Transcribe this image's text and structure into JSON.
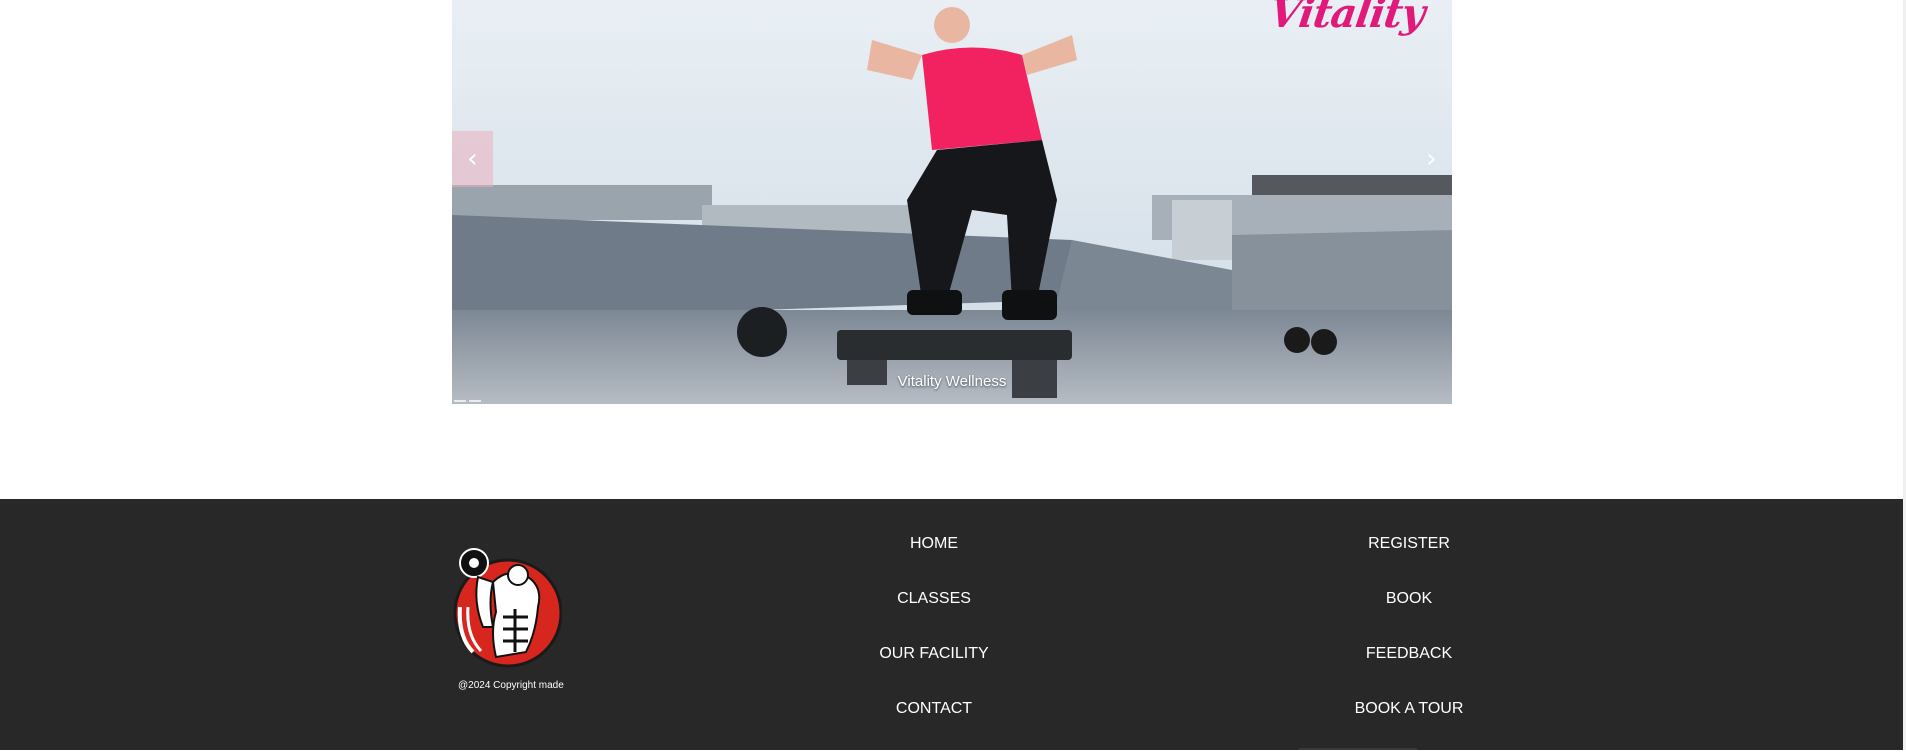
{
  "carousel": {
    "brand_text": "Vitality",
    "caption": "Vitality Wellness",
    "prev_label": "‹",
    "next_label": "›",
    "colors": {
      "accent_pink": "#e0197a",
      "sky": "#dfe8ef",
      "concrete": "#8f98a3"
    }
  },
  "footer": {
    "copyright": "@2024 Copyright made",
    "nav_left": [
      {
        "label": "HOME"
      },
      {
        "label": "CLASSES"
      },
      {
        "label": "OUR FACILITY"
      },
      {
        "label": "CONTACT"
      }
    ],
    "nav_right": [
      {
        "label": "REGISTER"
      },
      {
        "label": "BOOK"
      },
      {
        "label": "FEEDBACK"
      },
      {
        "label": "BOOK A TOUR"
      }
    ],
    "colors": {
      "background": "#282828",
      "text": "#ffffff",
      "logo_red": "#d7261e"
    }
  }
}
